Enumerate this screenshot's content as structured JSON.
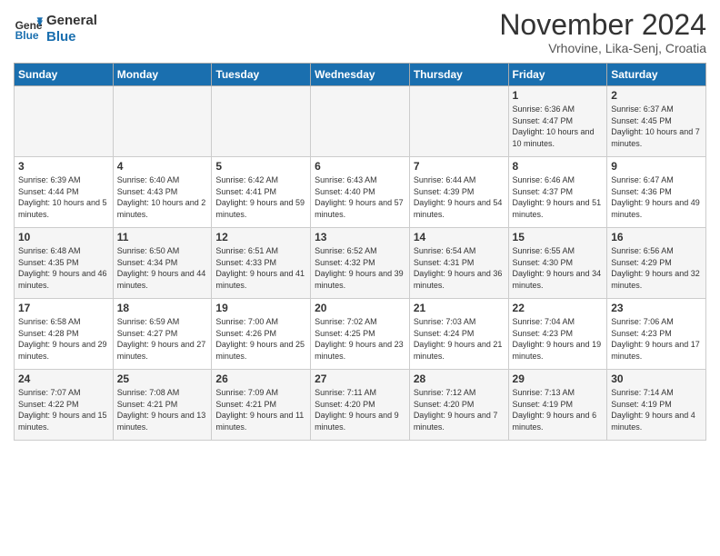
{
  "logo": {
    "line1": "General",
    "line2": "Blue"
  },
  "title": "November 2024",
  "subtitle": "Vrhovine, Lika-Senj, Croatia",
  "days_of_week": [
    "Sunday",
    "Monday",
    "Tuesday",
    "Wednesday",
    "Thursday",
    "Friday",
    "Saturday"
  ],
  "weeks": [
    [
      {
        "day": "",
        "info": ""
      },
      {
        "day": "",
        "info": ""
      },
      {
        "day": "",
        "info": ""
      },
      {
        "day": "",
        "info": ""
      },
      {
        "day": "",
        "info": ""
      },
      {
        "day": "1",
        "info": "Sunrise: 6:36 AM\nSunset: 4:47 PM\nDaylight: 10 hours\nand 10 minutes."
      },
      {
        "day": "2",
        "info": "Sunrise: 6:37 AM\nSunset: 4:45 PM\nDaylight: 10 hours\nand 7 minutes."
      }
    ],
    [
      {
        "day": "3",
        "info": "Sunrise: 6:39 AM\nSunset: 4:44 PM\nDaylight: 10 hours\nand 5 minutes."
      },
      {
        "day": "4",
        "info": "Sunrise: 6:40 AM\nSunset: 4:43 PM\nDaylight: 10 hours\nand 2 minutes."
      },
      {
        "day": "5",
        "info": "Sunrise: 6:42 AM\nSunset: 4:41 PM\nDaylight: 9 hours\nand 59 minutes."
      },
      {
        "day": "6",
        "info": "Sunrise: 6:43 AM\nSunset: 4:40 PM\nDaylight: 9 hours\nand 57 minutes."
      },
      {
        "day": "7",
        "info": "Sunrise: 6:44 AM\nSunset: 4:39 PM\nDaylight: 9 hours\nand 54 minutes."
      },
      {
        "day": "8",
        "info": "Sunrise: 6:46 AM\nSunset: 4:37 PM\nDaylight: 9 hours\nand 51 minutes."
      },
      {
        "day": "9",
        "info": "Sunrise: 6:47 AM\nSunset: 4:36 PM\nDaylight: 9 hours\nand 49 minutes."
      }
    ],
    [
      {
        "day": "10",
        "info": "Sunrise: 6:48 AM\nSunset: 4:35 PM\nDaylight: 9 hours\nand 46 minutes."
      },
      {
        "day": "11",
        "info": "Sunrise: 6:50 AM\nSunset: 4:34 PM\nDaylight: 9 hours\nand 44 minutes."
      },
      {
        "day": "12",
        "info": "Sunrise: 6:51 AM\nSunset: 4:33 PM\nDaylight: 9 hours\nand 41 minutes."
      },
      {
        "day": "13",
        "info": "Sunrise: 6:52 AM\nSunset: 4:32 PM\nDaylight: 9 hours\nand 39 minutes."
      },
      {
        "day": "14",
        "info": "Sunrise: 6:54 AM\nSunset: 4:31 PM\nDaylight: 9 hours\nand 36 minutes."
      },
      {
        "day": "15",
        "info": "Sunrise: 6:55 AM\nSunset: 4:30 PM\nDaylight: 9 hours\nand 34 minutes."
      },
      {
        "day": "16",
        "info": "Sunrise: 6:56 AM\nSunset: 4:29 PM\nDaylight: 9 hours\nand 32 minutes."
      }
    ],
    [
      {
        "day": "17",
        "info": "Sunrise: 6:58 AM\nSunset: 4:28 PM\nDaylight: 9 hours\nand 29 minutes."
      },
      {
        "day": "18",
        "info": "Sunrise: 6:59 AM\nSunset: 4:27 PM\nDaylight: 9 hours\nand 27 minutes."
      },
      {
        "day": "19",
        "info": "Sunrise: 7:00 AM\nSunset: 4:26 PM\nDaylight: 9 hours\nand 25 minutes."
      },
      {
        "day": "20",
        "info": "Sunrise: 7:02 AM\nSunset: 4:25 PM\nDaylight: 9 hours\nand 23 minutes."
      },
      {
        "day": "21",
        "info": "Sunrise: 7:03 AM\nSunset: 4:24 PM\nDaylight: 9 hours\nand 21 minutes."
      },
      {
        "day": "22",
        "info": "Sunrise: 7:04 AM\nSunset: 4:23 PM\nDaylight: 9 hours\nand 19 minutes."
      },
      {
        "day": "23",
        "info": "Sunrise: 7:06 AM\nSunset: 4:23 PM\nDaylight: 9 hours\nand 17 minutes."
      }
    ],
    [
      {
        "day": "24",
        "info": "Sunrise: 7:07 AM\nSunset: 4:22 PM\nDaylight: 9 hours\nand 15 minutes."
      },
      {
        "day": "25",
        "info": "Sunrise: 7:08 AM\nSunset: 4:21 PM\nDaylight: 9 hours\nand 13 minutes."
      },
      {
        "day": "26",
        "info": "Sunrise: 7:09 AM\nSunset: 4:21 PM\nDaylight: 9 hours\nand 11 minutes."
      },
      {
        "day": "27",
        "info": "Sunrise: 7:11 AM\nSunset: 4:20 PM\nDaylight: 9 hours\nand 9 minutes."
      },
      {
        "day": "28",
        "info": "Sunrise: 7:12 AM\nSunset: 4:20 PM\nDaylight: 9 hours\nand 7 minutes."
      },
      {
        "day": "29",
        "info": "Sunrise: 7:13 AM\nSunset: 4:19 PM\nDaylight: 9 hours\nand 6 minutes."
      },
      {
        "day": "30",
        "info": "Sunrise: 7:14 AM\nSunset: 4:19 PM\nDaylight: 9 hours\nand 4 minutes."
      }
    ]
  ]
}
